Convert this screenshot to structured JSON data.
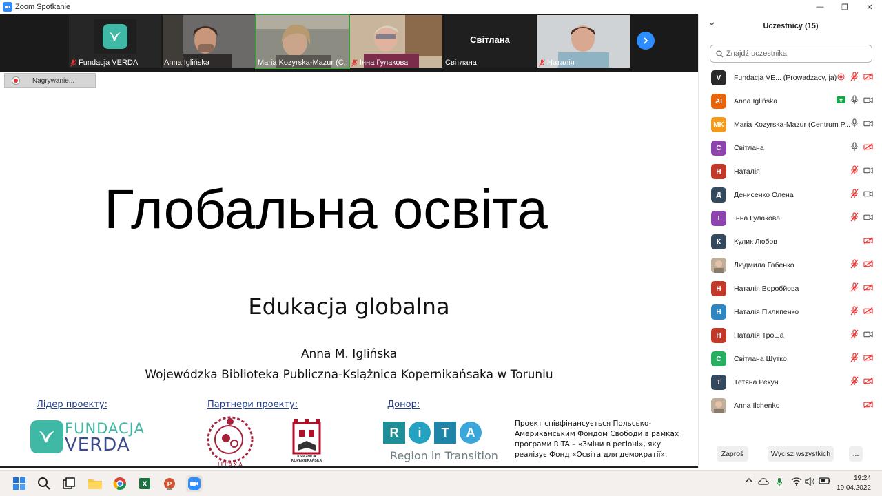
{
  "window": {
    "title": "Zoom Spotkanie",
    "controls": [
      "—",
      "❐",
      "✕"
    ]
  },
  "video_strip": {
    "tiles": [
      {
        "name": "Fundacja VERDA",
        "muted": true,
        "kind": "logo"
      },
      {
        "name": "Anna Iglińska",
        "muted": false,
        "kind": "photo"
      },
      {
        "name": "Maria Kozyrska-Mazur (C...",
        "muted": false,
        "kind": "photo",
        "active": true
      },
      {
        "name": "Інна Гулакова",
        "muted": true,
        "kind": "photo"
      },
      {
        "name": "Світлана",
        "muted": false,
        "kind": "name",
        "big_name": "Світлана"
      },
      {
        "name": "Наталія",
        "muted": true,
        "kind": "photo"
      }
    ]
  },
  "recording": {
    "label": "Nagrywanie..."
  },
  "slide": {
    "title": "Глобальна освіта",
    "subtitle": "Edukacja globalna",
    "author": "Anna M. Iglińska",
    "institution": "Wojewódzka Biblioteka Publiczna-Książnica Kopernikańsaka w Toruniu",
    "leader_label": "Лідер проекту:",
    "partners_label": "Партнери проекту:",
    "donor_label": "Донор:",
    "verda_logo": {
      "line1": "FUNDACJA",
      "line2": "VERDA"
    },
    "ptakha_text": "ПТАХА",
    "ksiaznica_text": [
      "KSIĄŻNICA",
      "KOPERNIKAŃSKA"
    ],
    "rita_letters": [
      "R",
      "i",
      "T",
      "A"
    ],
    "rita_colors": [
      "#1f8f97",
      "#23a3c1",
      "#1e84a8",
      "#3aa6d9"
    ],
    "rita_sub": "Region in Transition",
    "donor_text": "Проект співфінансується Польсько-Американським Фондом Свободи в рамках програми RITA – «Зміни в регіоні», яку реалізує Фонд «Освіта для демократії»."
  },
  "participants_panel": {
    "title": "Uczestnicy (15)",
    "search_placeholder": "Znajdź uczestnika",
    "participants": [
      {
        "initials": "V",
        "name": "Fundacja VE...  (Prowadzący, ja)",
        "color": "#2a2a2a",
        "mic": "muted",
        "video": "off",
        "extra": "record"
      },
      {
        "initials": "AI",
        "name": "Anna Iglińska",
        "color": "#e8630a",
        "mic": "on",
        "video": "on",
        "extra": "share"
      },
      {
        "initials": "MK",
        "name": "Maria Kozyrska-Mazur (Centrum P...",
        "color": "#f29a1f",
        "mic": "on",
        "video": "on"
      },
      {
        "initials": "С",
        "name": "Світлана",
        "color": "#8e44ad",
        "mic": "on",
        "video": "off"
      },
      {
        "initials": "Н",
        "name": " Наталія",
        "color": "#c0392b",
        "mic": "muted",
        "video": "on"
      },
      {
        "initials": "Д",
        "name": "Денисенко Олена",
        "color": "#34495e",
        "mic": "muted",
        "video": "on"
      },
      {
        "initials": "І",
        "name": "Інна Гулакова",
        "color": "#8e44ad",
        "mic": "muted",
        "video": "on"
      },
      {
        "initials": "К",
        "name": "Кулик Любов",
        "color": "#34495e",
        "mic": "none",
        "video": "off"
      },
      {
        "initials": "",
        "name": "Людмила Габенко",
        "color": "photo",
        "mic": "muted",
        "video": "off"
      },
      {
        "initials": "Н",
        "name": "Наталія Воробйова",
        "color": "#c0392b",
        "mic": "muted",
        "video": "off"
      },
      {
        "initials": "Н",
        "name": "Наталія Пилипенко",
        "color": "#2e86c1",
        "mic": "muted",
        "video": "off"
      },
      {
        "initials": "Н",
        "name": "Наталія Троша",
        "color": "#c0392b",
        "mic": "muted",
        "video": "on"
      },
      {
        "initials": "С",
        "name": "Світлана Шутко",
        "color": "#27ae60",
        "mic": "muted",
        "video": "off"
      },
      {
        "initials": "Т",
        "name": "Тетяна Рекун",
        "color": "#34495e",
        "mic": "muted",
        "video": "off"
      },
      {
        "initials": "",
        "name": "Anna Ilchenko",
        "color": "photo",
        "mic": "none",
        "video": "off"
      }
    ],
    "footer": {
      "invite": "Zaproś",
      "mute_all": "Wycisz wszystkich",
      "more": "..."
    }
  },
  "taskbar": {
    "time": "19:24",
    "date": "19.04.2022"
  }
}
